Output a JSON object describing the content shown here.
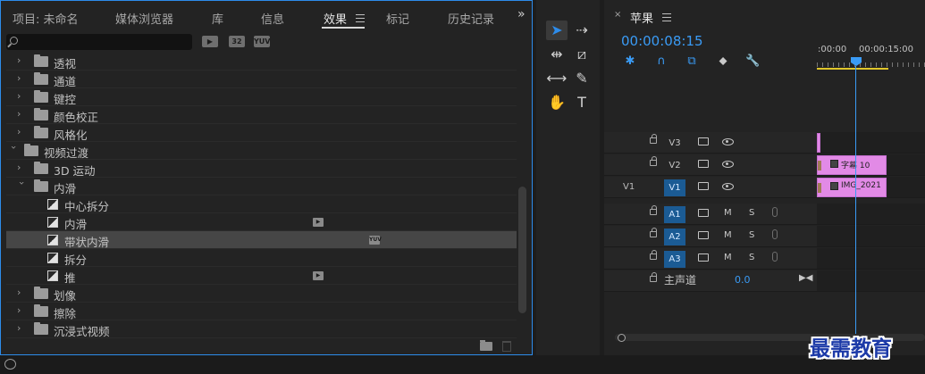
{
  "effects_panel": {
    "tabs": [
      {
        "label": "项目: 未命名"
      },
      {
        "label": "媒体浏览器"
      },
      {
        "label": "库"
      },
      {
        "label": "信息"
      },
      {
        "label": "效果",
        "active": true
      },
      {
        "label": "标记"
      },
      {
        "label": "历史记录"
      }
    ],
    "overflow": "»",
    "search": {
      "value": "",
      "placeholder": ""
    },
    "filters": [
      "▶",
      "32",
      "YUV"
    ],
    "tree": [
      {
        "label": "透视",
        "type": "folder",
        "level": 1,
        "expanded": false
      },
      {
        "label": "通道",
        "type": "folder",
        "level": 1,
        "expanded": false
      },
      {
        "label": "键控",
        "type": "folder",
        "level": 1,
        "expanded": false
      },
      {
        "label": "颜色校正",
        "type": "folder",
        "level": 1,
        "expanded": false
      },
      {
        "label": "风格化",
        "type": "folder",
        "level": 1,
        "expanded": false
      },
      {
        "label": "视频过渡",
        "type": "folder",
        "level": 0,
        "expanded": true
      },
      {
        "label": "3D 运动",
        "type": "folder",
        "level": 1,
        "expanded": false
      },
      {
        "label": "内滑",
        "type": "folder",
        "level": 1,
        "expanded": true
      },
      {
        "label": "中心拆分",
        "type": "effect",
        "level": 2
      },
      {
        "label": "内滑",
        "type": "effect",
        "level": 2,
        "badge": "accelerated"
      },
      {
        "label": "带状内滑",
        "type": "effect",
        "level": 2,
        "badge": "yuv",
        "selected": true
      },
      {
        "label": "拆分",
        "type": "effect",
        "level": 2
      },
      {
        "label": "推",
        "type": "effect",
        "level": 2,
        "badge": "accelerated"
      },
      {
        "label": "划像",
        "type": "folder",
        "level": 1,
        "expanded": false
      },
      {
        "label": "擦除",
        "type": "folder",
        "level": 1,
        "expanded": false
      },
      {
        "label": "沉浸式视频",
        "type": "folder",
        "level": 1,
        "expanded": false
      }
    ]
  },
  "tools": [
    "selection-tool",
    "track-select-forward-tool",
    "ripple-edit-tool",
    "razor-tool",
    "slip-tool",
    "pen-tool",
    "hand-tool",
    "type-tool"
  ],
  "timeline": {
    "close": "×",
    "title": "苹果",
    "timecode": "00:00:08:15",
    "ruler_labels": [
      ":00:00",
      "00:00:15:00"
    ],
    "tracks": [
      {
        "name": "V3",
        "source": "",
        "kind": "video",
        "target": false,
        "clip": ""
      },
      {
        "name": "V2",
        "source": "",
        "kind": "video",
        "target": false,
        "clip": "字幕 10"
      },
      {
        "name": "V1",
        "source": "V1",
        "kind": "video",
        "target": true,
        "clip": "IMG_2021"
      },
      {
        "name": "A1",
        "source": "",
        "kind": "audio",
        "target": true
      },
      {
        "name": "A2",
        "source": "",
        "kind": "audio",
        "target": true
      },
      {
        "name": "A3",
        "source": "",
        "kind": "audio",
        "target": true
      }
    ],
    "mute_label": "M",
    "solo_label": "S",
    "master": {
      "label": "主声道",
      "value": "0.0"
    }
  },
  "watermark": "最需教育",
  "colors": {
    "accent": "#2d8ceb",
    "clip": "#e28ae6",
    "playhead": "#3a9bf5"
  }
}
